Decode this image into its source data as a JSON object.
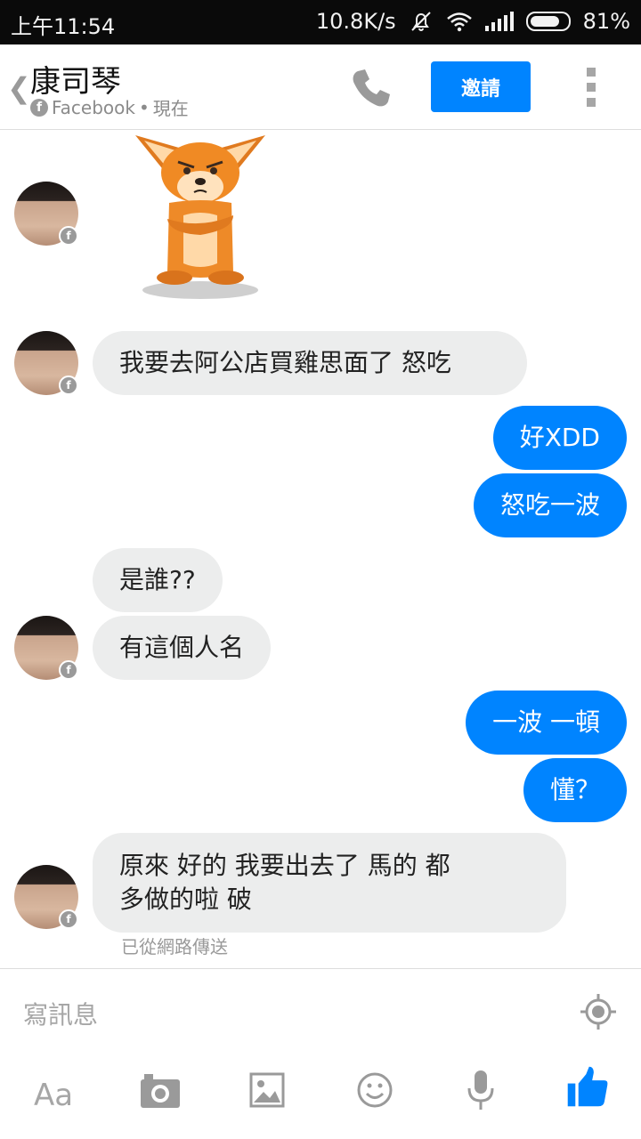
{
  "status_bar": {
    "time": "上午11:54",
    "speed": "10.8K/s",
    "battery": "81%"
  },
  "header": {
    "contact_name": "康司琴",
    "source": "Facebook",
    "separator": "•",
    "presence": "現在",
    "invite_label": "邀請"
  },
  "messages": [
    {
      "side": "in",
      "type": "sticker",
      "sticker": "angry-fox"
    },
    {
      "side": "in",
      "text": "我要去阿公店買雞思面了  怒吃"
    },
    {
      "side": "out",
      "text": "好XDD"
    },
    {
      "side": "out",
      "text": "怒吃一波"
    },
    {
      "side": "in",
      "text": "是誰??"
    },
    {
      "side": "in",
      "text": "有這個人名"
    },
    {
      "side": "out",
      "text": "一波  一頓"
    },
    {
      "side": "out",
      "text": "懂？"
    },
    {
      "side": "in",
      "lines": [
        "原來  好的  我要出去了  馬的  都",
        "多做的啦  破"
      ]
    }
  ],
  "sent_note": "已從網路傳送",
  "composer": {
    "placeholder": "寫訊息",
    "aa_label": "Aa",
    "tools": [
      "text-format-icon",
      "camera-icon",
      "gallery-icon",
      "emoji-icon",
      "microphone-icon",
      "like-icon"
    ]
  },
  "colors": {
    "accent": "#0084ff",
    "incoming_bubble": "#eceded",
    "status_bar": "#0a0a0a"
  }
}
